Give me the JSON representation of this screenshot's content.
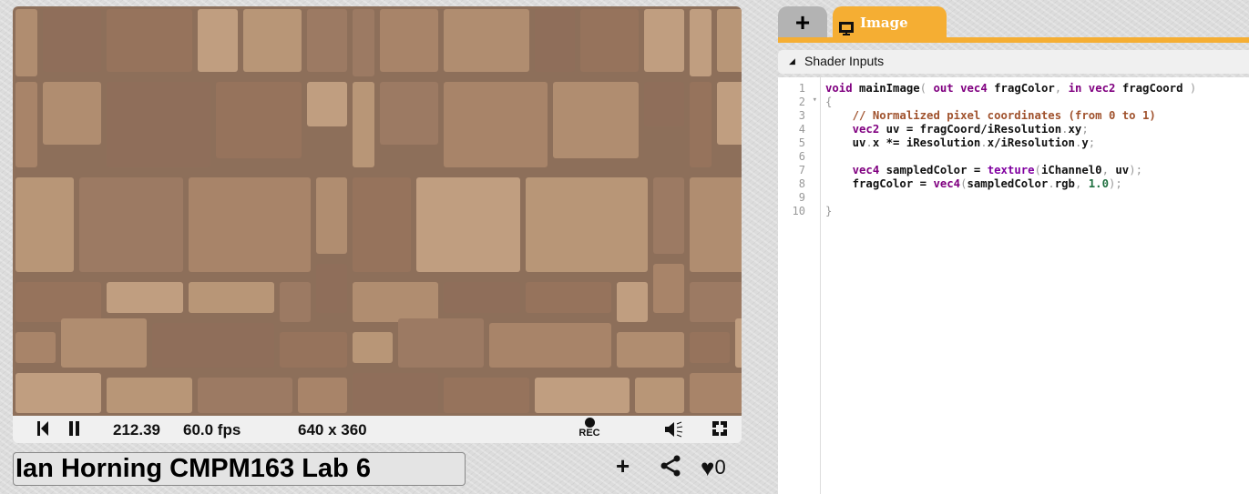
{
  "player": {
    "time": "212.39",
    "fps": "60.0 fps",
    "resolution": "640 x 360",
    "rec_label": "REC",
    "icons": [
      "rewind-icon",
      "pause-icon",
      "record-icon",
      "volume-icon",
      "fullscreen-icon"
    ]
  },
  "shader_title": "Ian Horning CMPM163 Lab 6",
  "actions": {
    "likes": "0"
  },
  "tabs": [
    {
      "label": "+"
    },
    {
      "label": "Image"
    }
  ],
  "shader_inputs_label": "Shader Inputs",
  "colors": {
    "accent": "#f5ae33",
    "keyword": "#800080",
    "comment": "#a0522d",
    "number": "#207040"
  },
  "code_lines": [
    [
      [
        "void",
        "kw"
      ],
      [
        " mainImage",
        "pl"
      ],
      [
        "(",
        "pu"
      ],
      [
        " out",
        "kw"
      ],
      [
        " vec4",
        "kw"
      ],
      [
        " fragColor",
        "pl"
      ],
      [
        ",",
        "pu"
      ],
      [
        " in",
        "kw"
      ],
      [
        " vec2",
        "kw"
      ],
      [
        " fragCoord ",
        "pl"
      ],
      [
        ")",
        "pu"
      ]
    ],
    [
      [
        "{",
        "pu"
      ]
    ],
    [
      [
        "    // Normalized pixel coordinates (from 0 to 1)",
        "cm"
      ]
    ],
    [
      [
        "    vec2",
        "kw"
      ],
      [
        " uv = fragCoord/iResolution",
        "pl"
      ],
      [
        ".",
        "pu"
      ],
      [
        "xy",
        "pl"
      ],
      [
        ";",
        "pu"
      ]
    ],
    [
      [
        "    uv",
        "pl"
      ],
      [
        ".",
        "pu"
      ],
      [
        "x *= iResolution",
        "pl"
      ],
      [
        ".",
        "pu"
      ],
      [
        "x/iResolution",
        "pl"
      ],
      [
        ".",
        "pu"
      ],
      [
        "y",
        "pl"
      ],
      [
        ";",
        "pu"
      ]
    ],
    [],
    [
      [
        "    vec4",
        "kw"
      ],
      [
        " sampledColor = ",
        "pl"
      ],
      [
        "texture",
        "fn"
      ],
      [
        "(",
        "pu"
      ],
      [
        "iChannel0",
        "pl"
      ],
      [
        ",",
        "pu"
      ],
      [
        " uv",
        "pl"
      ],
      [
        ")",
        "pu"
      ],
      [
        ";",
        "pu"
      ]
    ],
    [
      [
        "    fragColor = ",
        "pl"
      ],
      [
        "vec4",
        "kw"
      ],
      [
        "(",
        "pu"
      ],
      [
        "sampledColor",
        "pl"
      ],
      [
        ".",
        "pu"
      ],
      [
        "rgb",
        "pl"
      ],
      [
        ",",
        "pu"
      ],
      [
        " ",
        "pl"
      ],
      [
        "1.0",
        "num"
      ],
      [
        ")",
        "pu"
      ],
      [
        ";",
        "pu"
      ]
    ],
    [],
    [
      [
        "}",
        "pu"
      ]
    ]
  ]
}
